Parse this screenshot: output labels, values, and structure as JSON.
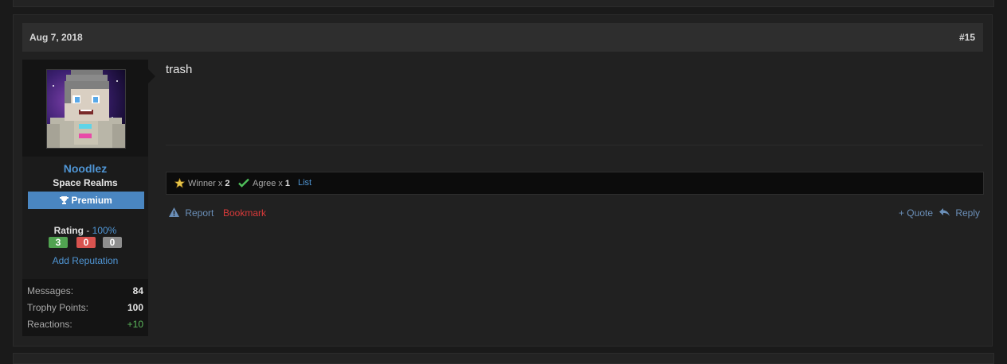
{
  "post": {
    "date": "Aug 7, 2018",
    "number": "#15",
    "message": "trash"
  },
  "user": {
    "name": "Noodlez",
    "title": "Space Realms",
    "badge": "Premium",
    "rating_label": "Rating",
    "rating_sep": " - ",
    "rating_pct": "100%",
    "rating_positive": "3",
    "rating_negative": "0",
    "rating_neutral": "0",
    "add_reputation": "Add Reputation",
    "stats": [
      {
        "label": "Messages:",
        "value": "84"
      },
      {
        "label": "Trophy Points:",
        "value": "100"
      },
      {
        "label": "Reactions:",
        "value": "+10"
      }
    ]
  },
  "reactions": {
    "items": [
      {
        "icon": "star-badge-icon",
        "label": "Winner x",
        "count": "2"
      },
      {
        "icon": "checkmark-icon",
        "label": "Agree x",
        "count": "1"
      }
    ],
    "list_label": "List"
  },
  "actions": {
    "report": "Report",
    "bookmark": "Bookmark",
    "quote": "+ Quote",
    "reply": "Reply"
  },
  "colors": {
    "link": "#4f95d4",
    "bookmark": "#d93a3a",
    "premium": "#4a86c1"
  }
}
